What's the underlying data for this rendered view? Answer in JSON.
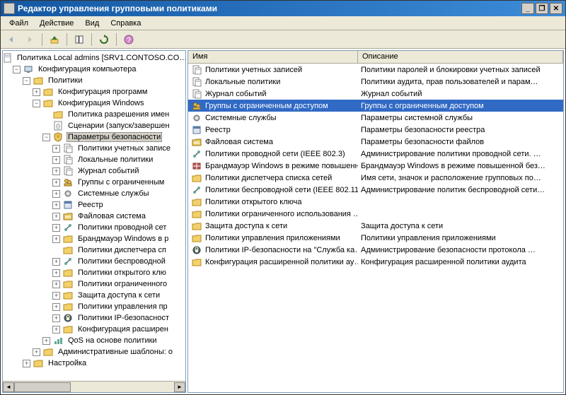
{
  "window": {
    "title": "Редактор управления групповыми политиками"
  },
  "menu": {
    "file": "Файл",
    "action": "Действие",
    "view": "Вид",
    "help": "Справка"
  },
  "columns": {
    "name": "Имя",
    "desc": "Описание"
  },
  "tree": [
    {
      "depth": 0,
      "toggle": "",
      "icon": "doc",
      "label": "Политика Local admins [SRV1.CONTOSO.CO…",
      "sel": false
    },
    {
      "depth": 1,
      "toggle": "-",
      "icon": "computer",
      "label": "Конфигурация компьютера",
      "sel": false
    },
    {
      "depth": 2,
      "toggle": "-",
      "icon": "folder",
      "label": "Политики",
      "sel": false
    },
    {
      "depth": 3,
      "toggle": "+",
      "icon": "folder",
      "label": "Конфигурация программ",
      "sel": false
    },
    {
      "depth": 3,
      "toggle": "-",
      "icon": "folder",
      "label": "Конфигурация Windows",
      "sel": false
    },
    {
      "depth": 4,
      "toggle": "",
      "icon": "folder",
      "label": "Политика разрешения имен",
      "sel": false
    },
    {
      "depth": 4,
      "toggle": "",
      "icon": "script",
      "label": "Сценарии (запуск/завершен",
      "sel": false
    },
    {
      "depth": 4,
      "toggle": "-",
      "icon": "shield",
      "label": "Параметры безопасности",
      "sel": true
    },
    {
      "depth": 5,
      "toggle": "+",
      "icon": "doc2",
      "label": "Политики учетных записе",
      "sel": false
    },
    {
      "depth": 5,
      "toggle": "+",
      "icon": "doc2",
      "label": "Локальные политики",
      "sel": false
    },
    {
      "depth": 5,
      "toggle": "+",
      "icon": "doc2",
      "label": "Журнал событий",
      "sel": false
    },
    {
      "depth": 5,
      "toggle": "+",
      "icon": "group",
      "label": "Группы с ограниченным",
      "sel": false
    },
    {
      "depth": 5,
      "toggle": "+",
      "icon": "gear",
      "label": "Системные службы",
      "sel": false
    },
    {
      "depth": 5,
      "toggle": "+",
      "icon": "reg",
      "label": "Реестр",
      "sel": false
    },
    {
      "depth": 5,
      "toggle": "+",
      "icon": "folder2",
      "label": "Файловая система",
      "sel": false
    },
    {
      "depth": 5,
      "toggle": "+",
      "icon": "net",
      "label": "Политики проводной сет",
      "sel": false
    },
    {
      "depth": 5,
      "toggle": "+",
      "icon": "folder",
      "label": "Брандмауэр Windows в р",
      "sel": false
    },
    {
      "depth": 5,
      "toggle": "",
      "icon": "folder",
      "label": "Политики диспетчера сп",
      "sel": false
    },
    {
      "depth": 5,
      "toggle": "+",
      "icon": "net",
      "label": "Политики беспроводной",
      "sel": false
    },
    {
      "depth": 5,
      "toggle": "+",
      "icon": "folder",
      "label": "Политики открытого клю",
      "sel": false
    },
    {
      "depth": 5,
      "toggle": "+",
      "icon": "folder",
      "label": "Политики ограниченного",
      "sel": false
    },
    {
      "depth": 5,
      "toggle": "+",
      "icon": "folder",
      "label": "Защита доступа к сети",
      "sel": false
    },
    {
      "depth": 5,
      "toggle": "+",
      "icon": "folder",
      "label": "Политики управления пр",
      "sel": false
    },
    {
      "depth": 5,
      "toggle": "+",
      "icon": "ipsec",
      "label": "Политики IP-безопасност",
      "sel": false
    },
    {
      "depth": 5,
      "toggle": "+",
      "icon": "folder",
      "label": "Конфигурация расширен",
      "sel": false
    },
    {
      "depth": 4,
      "toggle": "+",
      "icon": "qos",
      "label": "QoS на основе политики",
      "sel": false
    },
    {
      "depth": 3,
      "toggle": "+",
      "icon": "folder",
      "label": "Административные шаблоны: о",
      "sel": false
    },
    {
      "depth": 2,
      "toggle": "+",
      "icon": "folder",
      "label": "Настройка",
      "sel": false
    }
  ],
  "list": [
    {
      "icon": "doc2",
      "name": "Политики учетных записей",
      "desc": "Политики паролей и блокировки учетных записей",
      "sel": false
    },
    {
      "icon": "doc2",
      "name": "Локальные политики",
      "desc": "Политики аудита, прав пользователей и парам…",
      "sel": false
    },
    {
      "icon": "doc2",
      "name": "Журнал событий",
      "desc": "Журнал событий",
      "sel": false
    },
    {
      "icon": "group",
      "name": "Группы с ограниченным доступом",
      "desc": "Группы с ограниченным доступом",
      "sel": true
    },
    {
      "icon": "gear",
      "name": "Системные службы",
      "desc": "Параметры системной службы",
      "sel": false
    },
    {
      "icon": "reg",
      "name": "Реестр",
      "desc": "Параметры безопасности реестра",
      "sel": false
    },
    {
      "icon": "folder2",
      "name": "Файловая система",
      "desc": "Параметры безопасности файлов",
      "sel": false
    },
    {
      "icon": "net",
      "name": "Политики проводной сети (IEEE 802.3)",
      "desc": "Администрирование политики проводной сети. …",
      "sel": false
    },
    {
      "icon": "fw",
      "name": "Брандмауэр Windows в режиме повышенн…",
      "desc": "Брандмауэр Windows в режиме повышенной без…",
      "sel": false
    },
    {
      "icon": "folder",
      "name": "Политики диспетчера списка сетей",
      "desc": "Имя сети, значок и расположение групповых по…",
      "sel": false
    },
    {
      "icon": "net",
      "name": "Политики беспроводной сети (IEEE 802.11)",
      "desc": "Администрирование политик беспроводной сети…",
      "sel": false
    },
    {
      "icon": "folder",
      "name": "Политики открытого ключа",
      "desc": "",
      "sel": false
    },
    {
      "icon": "folder",
      "name": "Политики ограниченного использования …",
      "desc": "",
      "sel": false
    },
    {
      "icon": "folder",
      "name": "Защита доступа к сети",
      "desc": "Защита доступа к сети",
      "sel": false
    },
    {
      "icon": "folder",
      "name": "Политики управления приложениями",
      "desc": "Политики управления приложениями",
      "sel": false
    },
    {
      "icon": "ipsec",
      "name": "Политики IP-безопасности на \"Служба ка…",
      "desc": "Администрирование безопасности протокола …",
      "sel": false
    },
    {
      "icon": "folder",
      "name": "Конфигурация расширенной политики ау…",
      "desc": "Конфигурация расширенной политики аудита",
      "sel": false
    }
  ]
}
